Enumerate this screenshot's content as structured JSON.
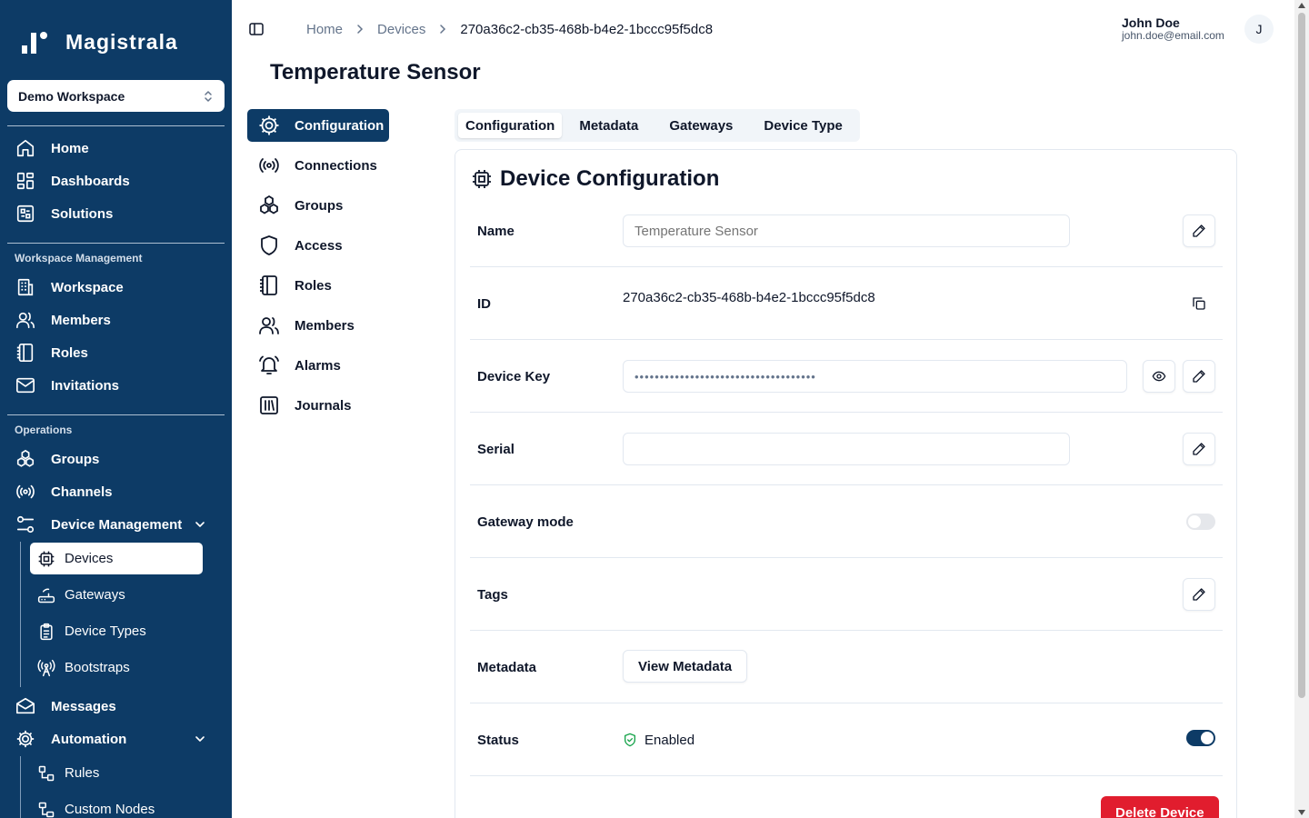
{
  "app": {
    "brand": "Magistrala",
    "workspace": "Demo Workspace"
  },
  "sidebar": {
    "top_items": [
      {
        "label": "Home",
        "icon": "home-icon"
      },
      {
        "label": "Dashboards",
        "icon": "dashboards-icon"
      },
      {
        "label": "Solutions",
        "icon": "solutions-icon"
      }
    ],
    "workspace_section": "Workspace Management",
    "workspace_items": [
      {
        "label": "Workspace",
        "icon": "building-icon"
      },
      {
        "label": "Members",
        "icon": "users-icon"
      },
      {
        "label": "Roles",
        "icon": "notebook-icon"
      },
      {
        "label": "Invitations",
        "icon": "mail-icon"
      }
    ],
    "operations_section": "Operations",
    "operations_items": [
      {
        "label": "Groups",
        "icon": "groups-icon"
      },
      {
        "label": "Channels",
        "icon": "radio-icon"
      },
      {
        "label": "Device Management",
        "icon": "settings-sliders-icon"
      }
    ],
    "device_sub_items": [
      {
        "label": "Devices",
        "icon": "chip-icon",
        "active": true
      },
      {
        "label": "Gateways",
        "icon": "router-icon"
      },
      {
        "label": "Device Types",
        "icon": "clipboard-icon"
      },
      {
        "label": "Bootstraps",
        "icon": "antenna-icon"
      }
    ],
    "more_items": [
      {
        "label": "Messages",
        "icon": "mail-open-icon"
      },
      {
        "label": "Automation",
        "icon": "gear-icon"
      }
    ],
    "automation_sub_items": [
      {
        "label": "Rules",
        "icon": "workflow-icon"
      },
      {
        "label": "Custom Nodes",
        "icon": "nodes-icon"
      }
    ]
  },
  "header": {
    "breadcrumb": [
      "Home",
      "Devices",
      "270a36c2-cb35-468b-b4e2-1bccc95f5dc8"
    ],
    "user_name": "John Doe",
    "user_email": "john.doe@email.com",
    "avatar_initial": "J"
  },
  "page": {
    "title": "Temperature Sensor"
  },
  "secondary_nav": [
    {
      "label": "Configuration",
      "icon": "gear-icon",
      "active": true
    },
    {
      "label": "Connections",
      "icon": "radio-icon"
    },
    {
      "label": "Groups",
      "icon": "groups-icon"
    },
    {
      "label": "Access",
      "icon": "shield-icon"
    },
    {
      "label": "Roles",
      "icon": "notebook-icon"
    },
    {
      "label": "Members",
      "icon": "users-icon"
    },
    {
      "label": "Alarms",
      "icon": "bell-icon"
    },
    {
      "label": "Journals",
      "icon": "library-icon"
    }
  ],
  "tabs": [
    {
      "label": "Configuration",
      "active": true
    },
    {
      "label": "Metadata"
    },
    {
      "label": "Gateways"
    },
    {
      "label": "Device Type"
    }
  ],
  "config": {
    "title": "Device Configuration",
    "name_label": "Name",
    "name_placeholder": "Temperature Sensor",
    "id_label": "ID",
    "id_value": "270a36c2-cb35-468b-b4e2-1bccc95f5dc8",
    "key_label": "Device Key",
    "key_masked": "••••••••••••••••••••••••••••••••••••",
    "serial_label": "Serial",
    "serial_value": "",
    "gateway_label": "Gateway mode",
    "gateway_mode": false,
    "tags_label": "Tags",
    "metadata_label": "Metadata",
    "metadata_button": "View Metadata",
    "status_label": "Status",
    "status_value": "Enabled",
    "status_enabled": true,
    "delete_button": "Delete Device"
  },
  "colors": {
    "sidebar": "#0d3b66",
    "accent": "#0d3b66",
    "danger": "#e11d2e",
    "success": "#16a34a"
  }
}
